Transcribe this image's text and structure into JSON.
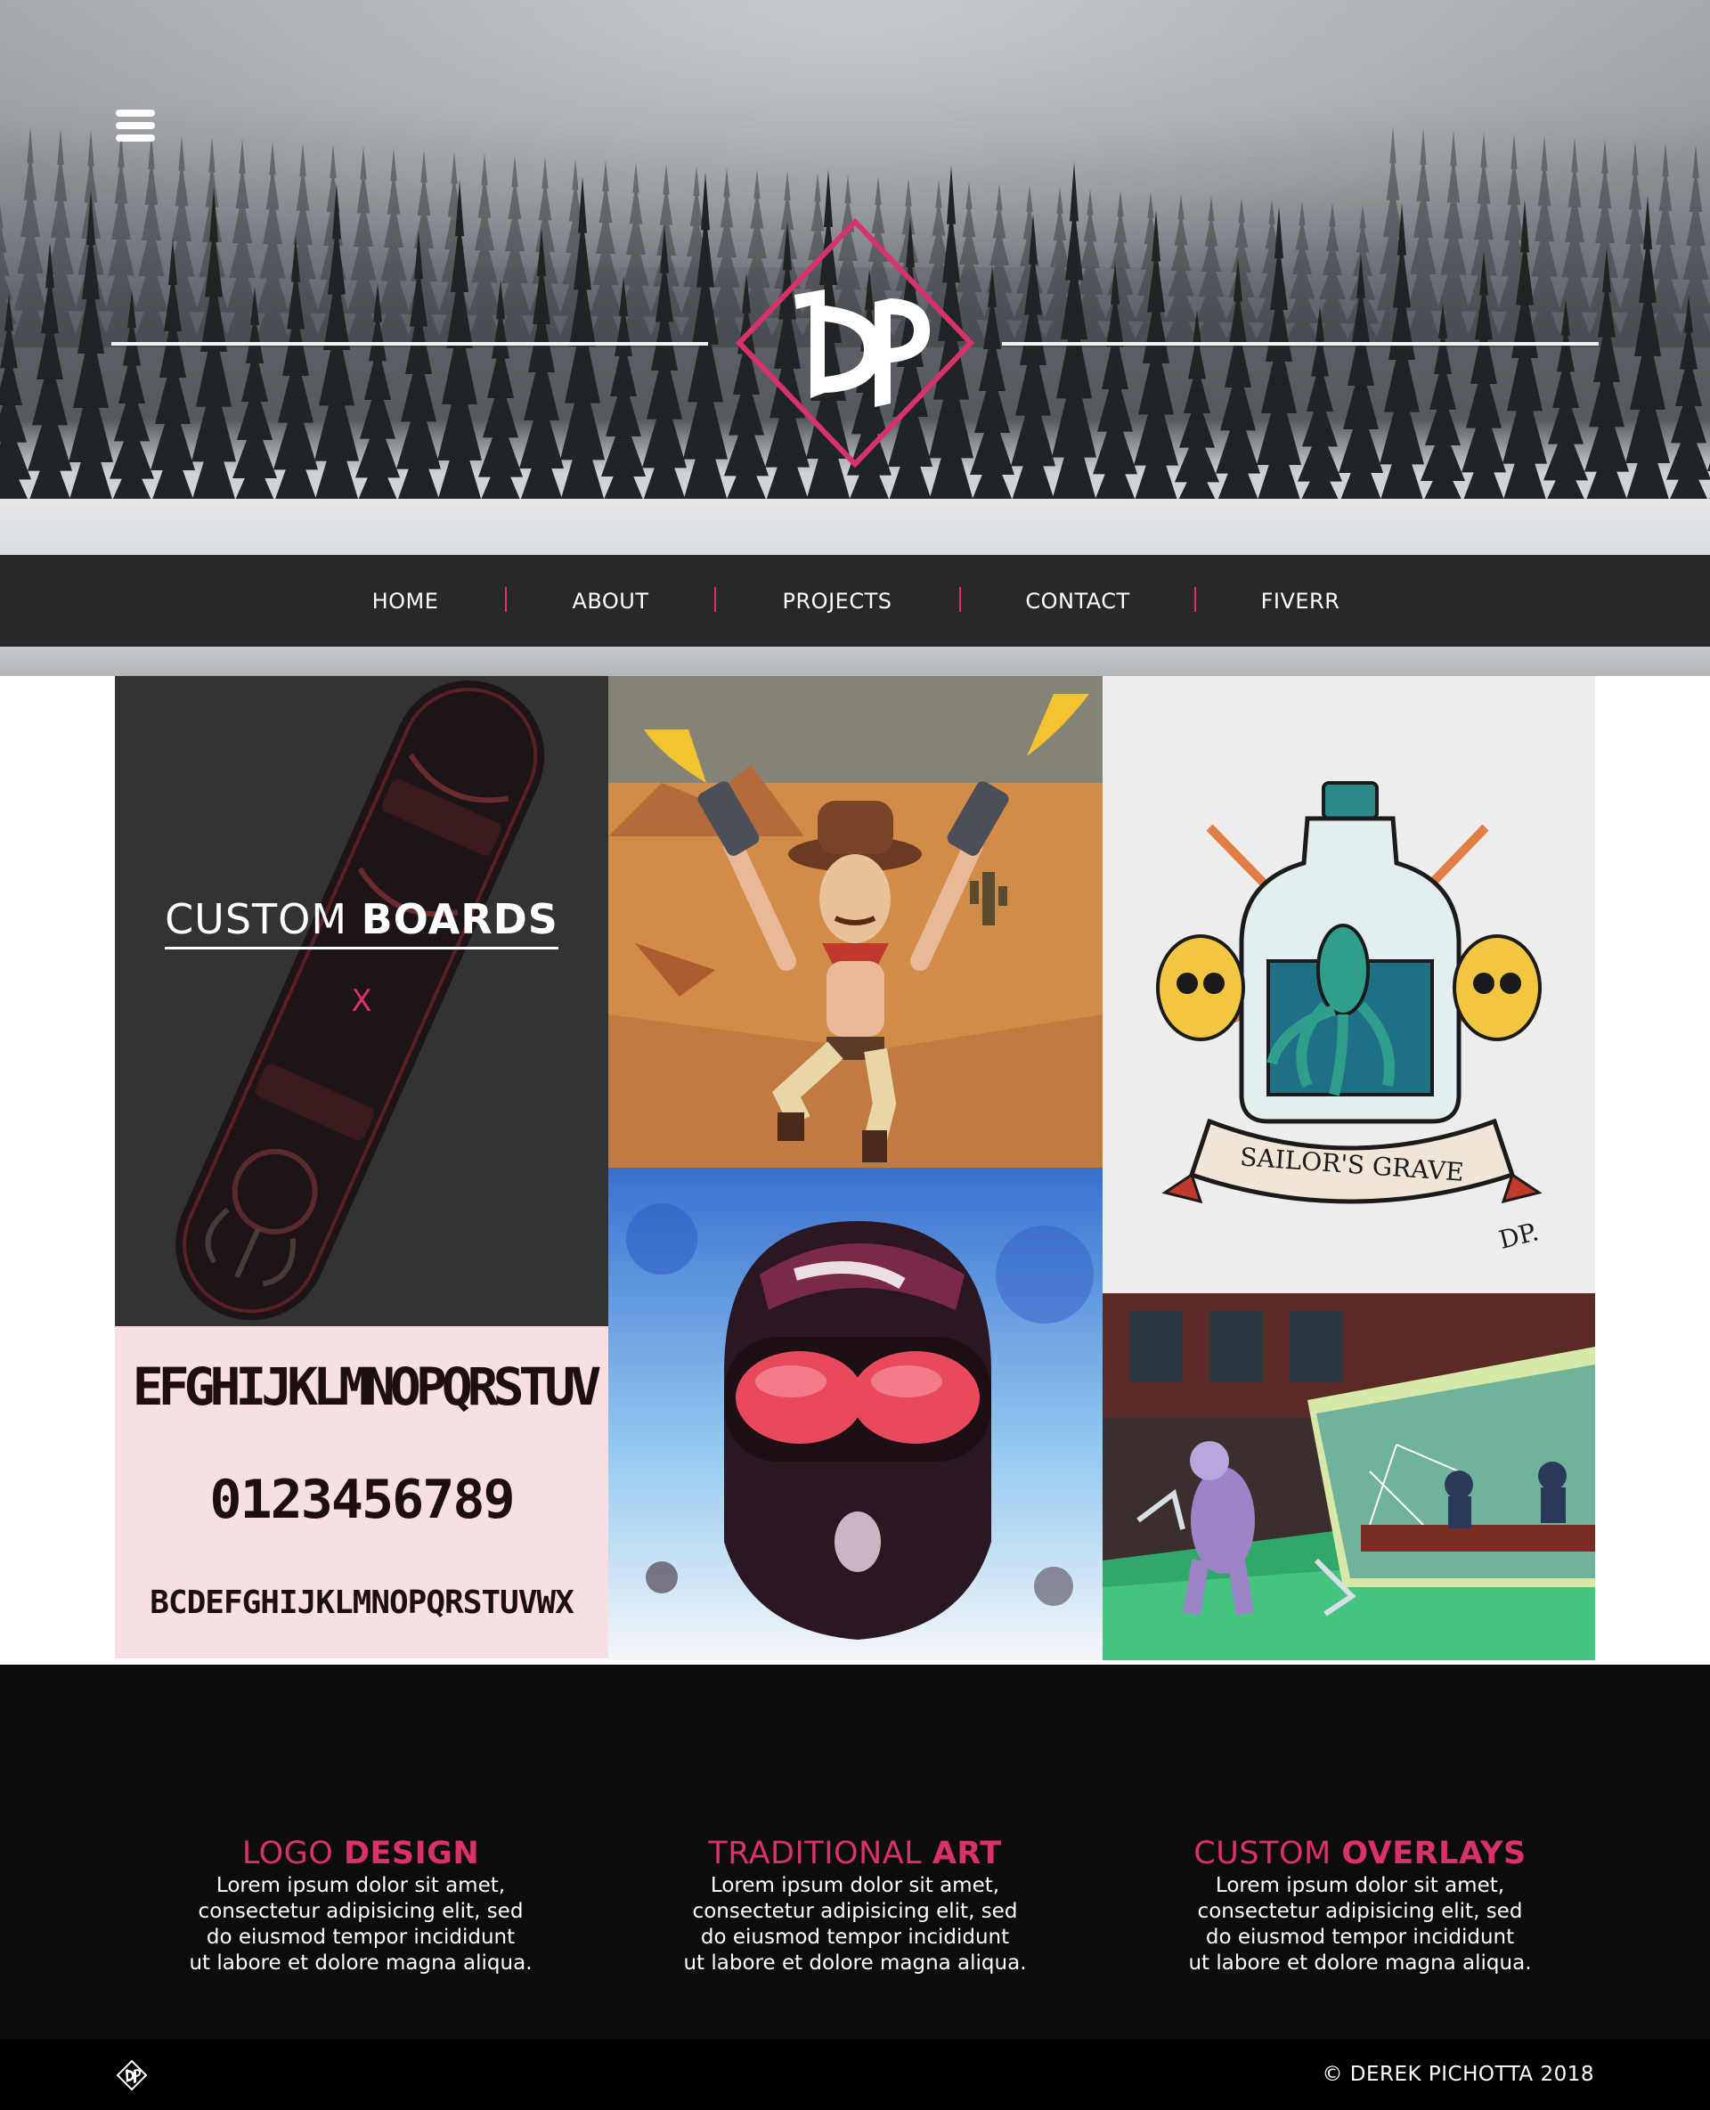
{
  "header": {
    "menu_icon": "hamburger-menu-icon",
    "logo_text": "DP",
    "logo_accent_color": "#d9326a"
  },
  "nav": {
    "items": [
      {
        "label": "HOME"
      },
      {
        "label": "ABOUT"
      },
      {
        "label": "PROJECTS"
      },
      {
        "label": "CONTACT"
      },
      {
        "label": "FIVERR"
      }
    ],
    "separator_color": "#d9326a"
  },
  "gallery": {
    "boards": {
      "title_thin": "CUSTOM",
      "title_bold": "BOARDS",
      "close_label": "X"
    },
    "font_sample": {
      "line1": "EFGHIJKLMNOPQRSTUV",
      "line2": "0123456789",
      "line3": "BCDEFGHIJKLMNOPQRSTUVWX"
    },
    "tattoo": {
      "banner_text": "SAILOR'S GRAVE",
      "signature": "DP."
    }
  },
  "features": [
    {
      "title_thin": "LOGO",
      "title_bold": "DESIGN",
      "lines": [
        "Lorem ipsum dolor sit amet,",
        "consectetur adipisicing elit, sed",
        "do eiusmod tempor incididunt",
        "ut labore et dolore magna aliqua."
      ]
    },
    {
      "title_thin": "TRADITIONAL",
      "title_bold": "ART",
      "lines": [
        "Lorem ipsum dolor sit amet,",
        "consectetur adipisicing elit, sed",
        "do eiusmod tempor incididunt",
        "ut labore et dolore magna aliqua."
      ]
    },
    {
      "title_thin": "CUSTOM",
      "title_bold": "OVERLAYS",
      "lines": [
        "Lorem ipsum dolor sit amet,",
        "consectetur adipisicing elit, sed",
        "do eiusmod tempor incididunt",
        "ut labore et dolore magna aliqua."
      ]
    }
  ],
  "footer": {
    "logo_icon": "dp-diamond-logo-icon",
    "copyright": "© DEREK PICHOTTA 2018"
  },
  "colors": {
    "accent": "#d9326a",
    "nav_bg": "#222224",
    "features_bg": "#0c0c0d",
    "footer_bg": "#000000"
  }
}
